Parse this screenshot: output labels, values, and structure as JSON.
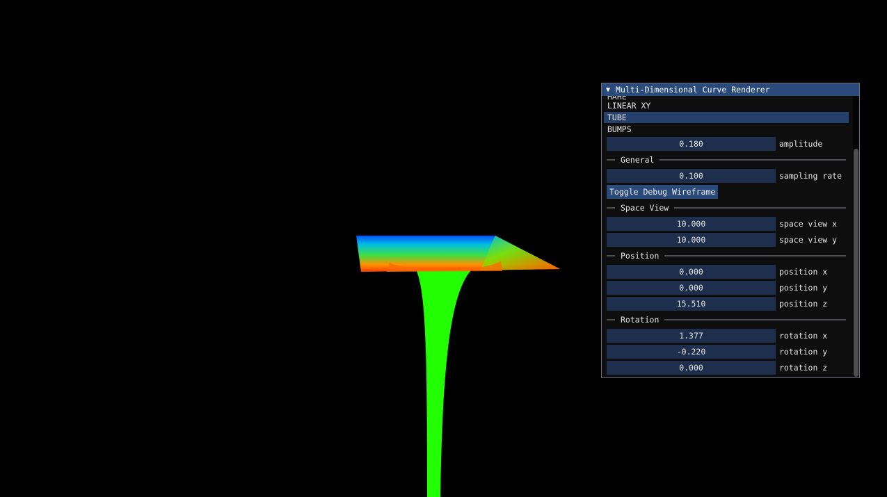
{
  "panel": {
    "title": "Multi-Dimensional Curve Renderer",
    "collapse_arrow": "▼",
    "curve_list": {
      "cut_item": "HAHE",
      "items": [
        "LINEAR XY",
        "TUBE",
        "BUMPS"
      ],
      "selected": "TUBE"
    },
    "amplitude": {
      "value": "0.180",
      "label": "amplitude"
    },
    "general": {
      "header": "General",
      "sampling_rate": {
        "value": "0.100",
        "label": "sampling rate"
      },
      "toggle_button": "Toggle Debug Wireframe"
    },
    "space_view": {
      "header": "Space View",
      "x": {
        "value": "10.000",
        "label": "space view x"
      },
      "y": {
        "value": "10.000",
        "label": "space view y"
      }
    },
    "position": {
      "header": "Position",
      "x": {
        "value": "0.000",
        "label": "position x"
      },
      "y": {
        "value": "0.000",
        "label": "position y"
      },
      "z": {
        "value": "15.510",
        "label": "position z"
      }
    },
    "rotation": {
      "header": "Rotation",
      "x": {
        "value": "1.377",
        "label": "rotation x"
      },
      "y": {
        "value": "-0.220",
        "label": "rotation y"
      },
      "z": {
        "value": "0.000",
        "label": "rotation z"
      }
    }
  },
  "colors": {
    "background": "#000000",
    "title_bar": "#294a7a",
    "field_bg": "#1d2f4c",
    "selected_bg": "#24406b",
    "button_bg": "#2a4b7a"
  }
}
